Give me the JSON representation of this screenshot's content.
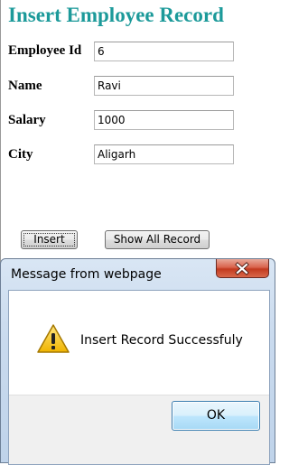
{
  "page": {
    "title": "Insert Employee Record"
  },
  "form": {
    "fields": [
      {
        "label": "Employee Id",
        "value": "6"
      },
      {
        "label": "Name",
        "value": "Ravi"
      },
      {
        "label": "Salary",
        "value": "1000"
      },
      {
        "label": "City",
        "value": "Aligarh"
      }
    ],
    "insert_label": "Insert",
    "show_all_label": "Show All Record"
  },
  "dialog": {
    "title": "Message from webpage",
    "message": "Insert Record Successfuly",
    "ok_label": "OK",
    "icon": "warning-icon",
    "close_icon": "close-icon"
  },
  "colors": {
    "title": "#1c9a9a",
    "dialog_frame": "#c9daee",
    "close_button": "#c23a1f"
  }
}
